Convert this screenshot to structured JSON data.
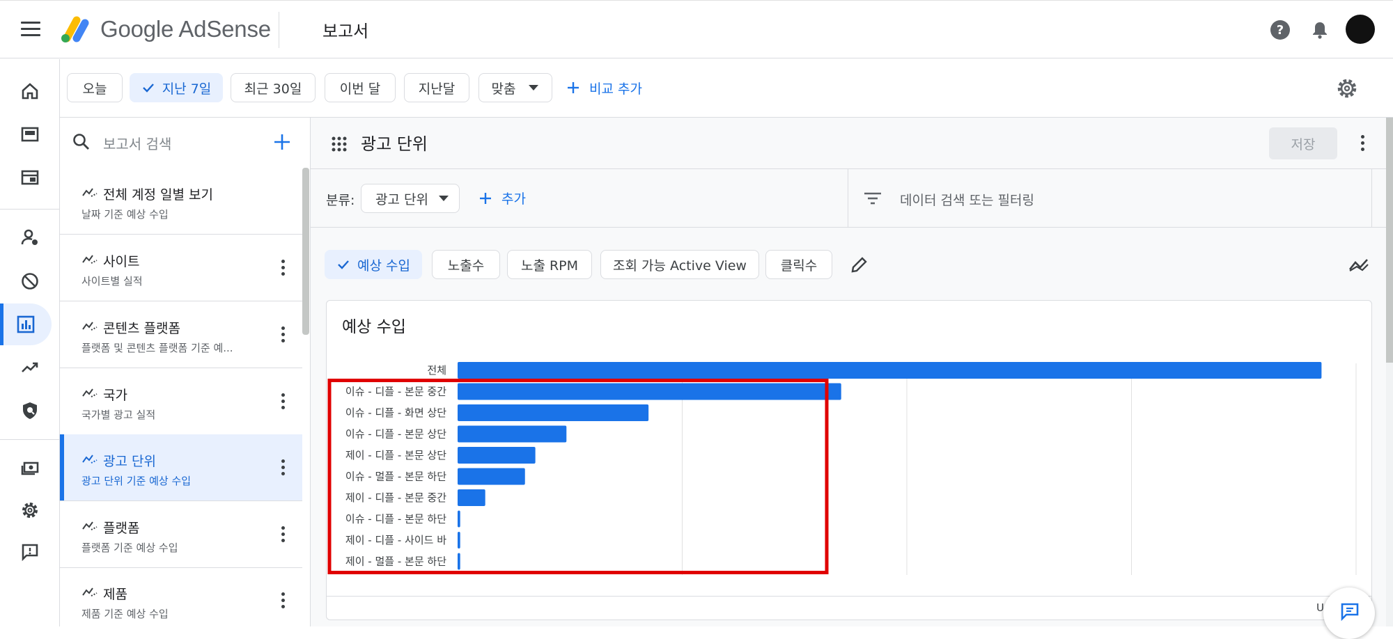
{
  "app": {
    "brand": "Google AdSense",
    "page_title": "보고서"
  },
  "icons": {
    "menu": "hamburger-menu-icon",
    "help": "help-icon",
    "notifications": "bell-icon",
    "avatar": "account-avatar"
  },
  "left_nav": [
    {
      "name": "home-icon"
    },
    {
      "name": "ads-icon"
    },
    {
      "name": "sites-icon"
    },
    {
      "name": "account-icon"
    },
    {
      "name": "block-icon"
    },
    {
      "name": "reports-icon",
      "active": true
    },
    {
      "name": "optimization-icon"
    },
    {
      "name": "privacy-icon"
    },
    {
      "name": "payments-icon"
    },
    {
      "name": "settings-icon"
    },
    {
      "name": "feedback-icon"
    }
  ],
  "date_chips": [
    {
      "label": "오늘"
    },
    {
      "label": "지난 7일",
      "selected": true
    },
    {
      "label": "최근 30일"
    },
    {
      "label": "이번 달"
    },
    {
      "label": "지난달"
    },
    {
      "label": "맞춤"
    }
  ],
  "add_comparison": "비교 추가",
  "sidebar": {
    "search_placeholder": "보고서 검색",
    "items": [
      {
        "title": "전체 계정 일별 보기",
        "subtitle": "날짜 기준 예상 수입"
      },
      {
        "title": "사이트",
        "subtitle": "사이트별 실적"
      },
      {
        "title": "콘텐츠 플랫폼",
        "subtitle": "플랫폼 및 콘텐츠 플랫폼 기준 예..."
      },
      {
        "title": "국가",
        "subtitle": "국가별 광고 실적"
      },
      {
        "title": "광고 단위",
        "subtitle": "광고 단위 기준 예상 수입",
        "active": true
      },
      {
        "title": "플랫폼",
        "subtitle": "플랫폼 기준 예상 수입"
      },
      {
        "title": "제품",
        "subtitle": "제품 기준 예상 수입"
      }
    ]
  },
  "main": {
    "title": "광고 단위",
    "save_label": "저장",
    "breakdown_label": "분류:",
    "breakdown_value": "광고 단위",
    "add_label": "추가",
    "filter_placeholder": "데이터 검색 또는 필터링",
    "metrics": [
      {
        "label": "예상 수입",
        "selected": true
      },
      {
        "label": "노출수"
      },
      {
        "label": "노출 RPM"
      },
      {
        "label": "조회 가능 Active View"
      },
      {
        "label": "클릭수"
      }
    ],
    "card_title": "예상 수입",
    "footer_text": "U"
  },
  "colors": {
    "accent": "#1a73e8",
    "bar": "#1a73e8",
    "highlight_box": "#e00000"
  },
  "chart_data": {
    "type": "bar",
    "orientation": "horizontal",
    "title": "예상 수입",
    "categories": [
      "전체",
      "이슈 - 디플 - 본문 중간",
      "이슈 - 디플 - 화면 상단",
      "이슈 - 디플 - 본문 상단",
      "제이 - 디플 - 본문 상단",
      "이슈 - 멀플 - 본문 하단",
      "제이 - 디플 - 본문 중간",
      "이슈 - 디플 - 본문 하단",
      "제이 - 디플 - 사이드 바",
      "제이 - 멀플 - 본문 하단"
    ],
    "values": [
      1.0,
      0.444,
      0.221,
      0.126,
      0.09,
      0.078,
      0.032,
      0.003,
      0.003,
      0.003
    ],
    "xlim": [
      0,
      1.04
    ],
    "grid": true,
    "highlighted_range": [
      1,
      9
    ]
  }
}
